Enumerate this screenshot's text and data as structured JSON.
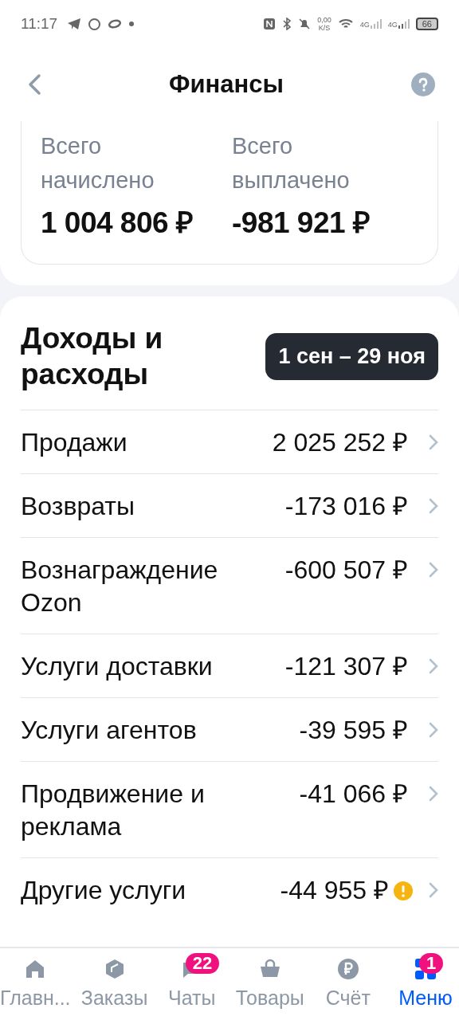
{
  "status_bar": {
    "time": "11:17",
    "speed": "0,00",
    "speed_unit": "K/S",
    "network_1": "4G",
    "network_2": "4G",
    "battery": "66"
  },
  "header": {
    "title": "Финансы"
  },
  "summary": [
    {
      "label": "Всего начислено",
      "value": "1 004 806 ₽"
    },
    {
      "label": "Всего выплачено",
      "value": "-981 921 ₽"
    }
  ],
  "income": {
    "title": "Доходы и расходы",
    "period": "1 сен – 29 ноя",
    "rows": [
      {
        "label": "Продажи",
        "value": "2 025 252 ₽",
        "warning": false
      },
      {
        "label": "Возвраты",
        "value": "-173 016 ₽",
        "warning": false
      },
      {
        "label": "Вознаграждение Ozon",
        "value": "-600 507 ₽",
        "warning": false
      },
      {
        "label": "Услуги доставки",
        "value": "-121 307 ₽",
        "warning": false
      },
      {
        "label": "Услуги агентов",
        "value": "-39 595 ₽",
        "warning": false
      },
      {
        "label": "Продвижение и реклама",
        "value": "-41 066 ₽",
        "warning": false
      },
      {
        "label": "Другие услуги",
        "value": "-44 955 ₽",
        "warning": true
      }
    ]
  },
  "nav": [
    {
      "label": "Главн...",
      "selected": false
    },
    {
      "label": "Заказы",
      "selected": false
    },
    {
      "label": "Чаты",
      "selected": false,
      "badge": "22"
    },
    {
      "label": "Товары",
      "selected": false
    },
    {
      "label": "Счёт",
      "selected": false
    },
    {
      "label": "Меню",
      "selected": true,
      "badge": "1"
    }
  ]
}
